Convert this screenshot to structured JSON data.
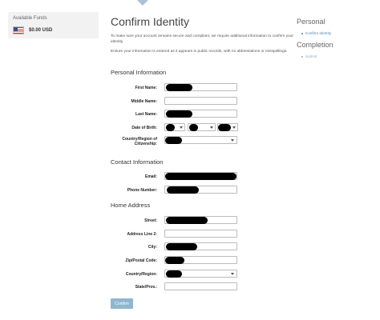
{
  "funds": {
    "label": "Available Funds",
    "amount": "$0.00 USD",
    "flag_icon": "us-flag-icon"
  },
  "page": {
    "title": "Confirm Identity",
    "intro1": "To make sure your account remains secure and compliant, we require additional information to confirm your identity.",
    "intro2": "Ensure your information is entered as it appears in public records, with no abbreviations or misspellings."
  },
  "sections": {
    "personal": "Personal Information",
    "contact": "Contact Information",
    "home": "Home Address"
  },
  "fields": {
    "first_name": "First Name:",
    "middle_name": "Middle Name:",
    "last_name": "Last Name:",
    "dob": "Date of Birth:",
    "citizenship": "Country/Region of Citizenship:",
    "email": "Email:",
    "phone": "Phone Number:",
    "street": "Street:",
    "address2": "Address Line 2:",
    "city": "City:",
    "zip": "Zip/Postal Code:",
    "country": "Country/Region:",
    "state": "State/Prov.:"
  },
  "submit_label": "Confirm",
  "sidebar": {
    "personal_title": "Personal",
    "personal_item": "Confirm Identity",
    "completion_title": "Completion",
    "completion_item": "Submit"
  },
  "colors": {
    "accent": "#4a86b5",
    "button": "#8fb7cf"
  }
}
